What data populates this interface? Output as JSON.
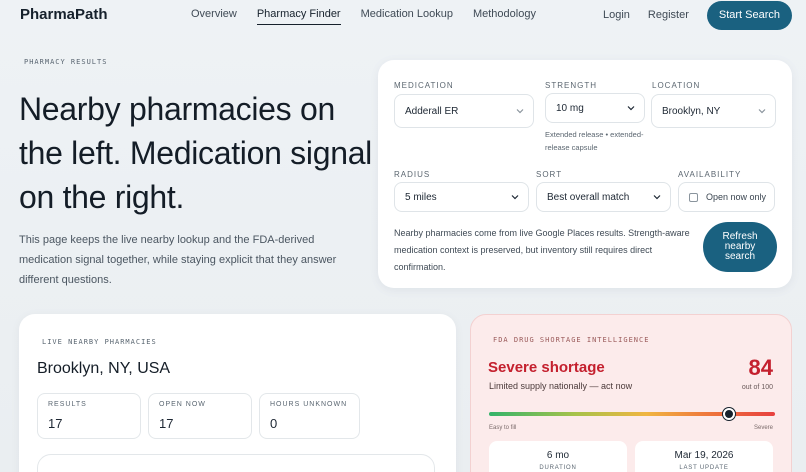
{
  "nav": {
    "brand": "PharmaPath",
    "links": [
      {
        "label": "Overview"
      },
      {
        "label": "Pharmacy Finder",
        "active": true
      },
      {
        "label": "Medication Lookup"
      },
      {
        "label": "Methodology"
      }
    ],
    "login": "Login",
    "register": "Register",
    "cta": "Start Search"
  },
  "hero": {
    "eyebrow": "PHARMACY RESULTS",
    "title": "Nearby pharmacies on the left. Medication signal on the right.",
    "subtitle": "This page keeps the live nearby lookup and the FDA-derived medication signal together, while staying explicit that they answer different questions."
  },
  "search": {
    "medication_label": "MEDICATION",
    "medication_value": "Adderall ER",
    "strength_label": "STRENGTH",
    "strength_value": "10 mg",
    "strength_hint": "Extended release • extended-release capsule",
    "location_label": "LOCATION",
    "location_value": "Brooklyn, NY",
    "radius_label": "RADIUS",
    "radius_value": "5 miles",
    "sort_label": "SORT",
    "sort_value": "Best overall match",
    "availability_label": "AVAILABILITY",
    "open_now_label": "Open now only",
    "note": "Nearby pharmacies come from live Google Places results. Strength-aware medication context is preserved, but inventory still requires direct confirmation.",
    "refresh_label": "Refresh nearby search"
  },
  "live": {
    "eyebrow": "LIVE NEARBY PHARMACIES",
    "city": "Brooklyn, NY, USA",
    "stats": [
      {
        "label": "RESULTS",
        "value": "17"
      },
      {
        "label": "OPEN NOW",
        "value": "17"
      },
      {
        "label": "HOURS UNKNOWN",
        "value": "0"
      }
    ]
  },
  "shortage": {
    "eyebrow": "FDA DRUG SHORTAGE INTELLIGENCE",
    "title": "Severe shortage",
    "subtitle": "Limited supply nationally — act now",
    "score": "84",
    "score_out_of": "out of 100",
    "score_fraction": 0.84,
    "scale_low": "Easy to fill",
    "scale_high": "Severe",
    "duration_value": "6 mo",
    "duration_label": "DURATION",
    "last_update_value": "Mar 19, 2026",
    "last_update_label": "LAST UPDATE",
    "accent_color": "#c4202e"
  },
  "colors": {
    "primary": "#1a6180",
    "background": "#eef2f5",
    "shortage_bg": "#fcebeb"
  }
}
